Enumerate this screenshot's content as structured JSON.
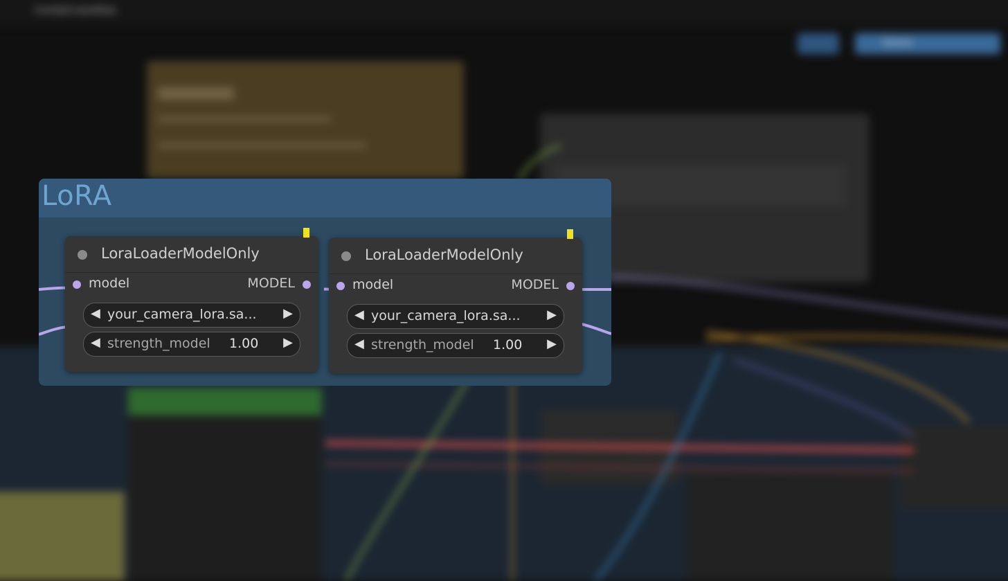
{
  "background": {
    "tab_title": "ComfyUI workflow",
    "toolbar_label": "Queue"
  },
  "group": {
    "title": "LoRA",
    "color": "#2d4a61"
  },
  "nodes": [
    {
      "title": "LoraLoaderModelOnly",
      "input": "model",
      "output": "MODEL",
      "lora_name": "your_camera_lora.sa...",
      "strength_label": "strength_model",
      "strength_value": "1.00"
    },
    {
      "title": "LoraLoaderModelOnly",
      "input": "model",
      "output": "MODEL",
      "lora_name": "your_camera_lora.sa...",
      "strength_label": "strength_model",
      "strength_value": "1.00"
    }
  ],
  "icons": {
    "left_arrow": "◀",
    "right_arrow": "▶"
  },
  "colors": {
    "badge": "#f0e21d",
    "model_wire": "#b8a5ec"
  }
}
